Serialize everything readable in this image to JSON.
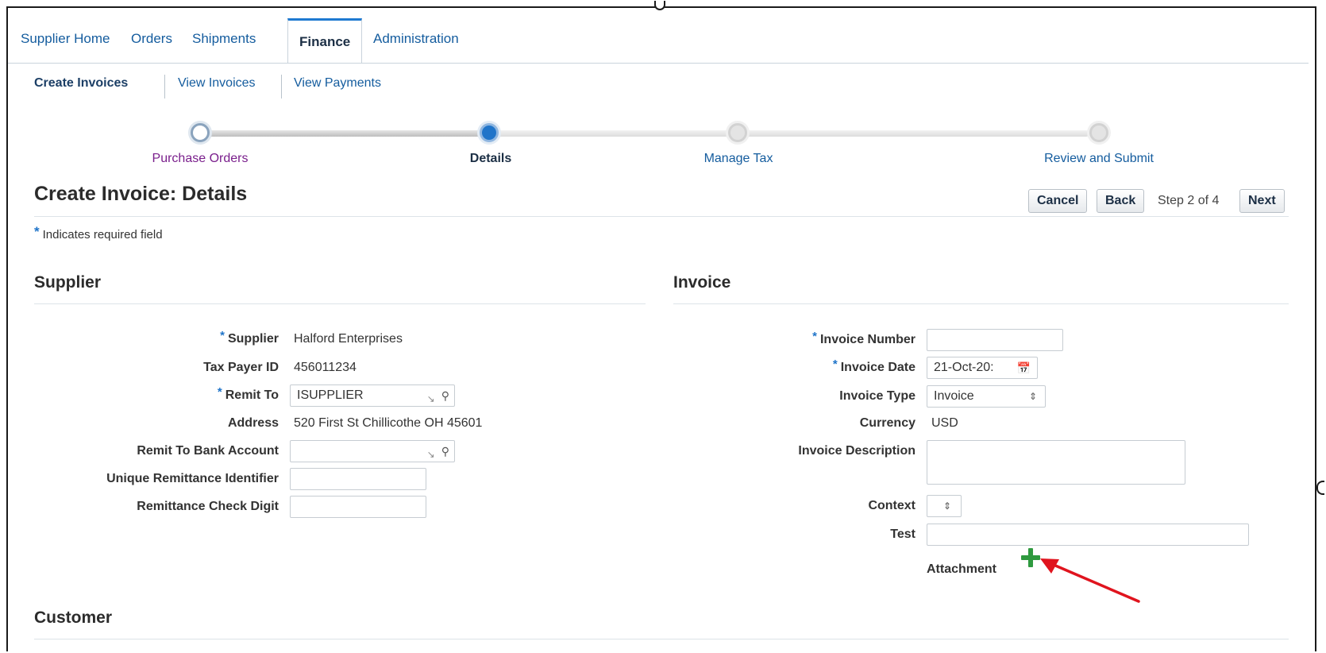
{
  "tabs": [
    {
      "label": "Supplier Home"
    },
    {
      "label": "Orders"
    },
    {
      "label": "Shipments"
    },
    {
      "label": "Finance"
    },
    {
      "label": "Administration"
    }
  ],
  "active_tab": "Finance",
  "subnav": [
    {
      "label": "Create Invoices"
    },
    {
      "label": "View Invoices"
    },
    {
      "label": "View Payments"
    }
  ],
  "train": [
    {
      "label": "Purchase Orders",
      "state": "visited"
    },
    {
      "label": "Details",
      "state": "current"
    },
    {
      "label": "Manage Tax",
      "state": "future"
    },
    {
      "label": "Review and Submit",
      "state": "future"
    }
  ],
  "page": {
    "title": "Create Invoice: Details",
    "required_note": "Indicates required field",
    "required_marker": "*",
    "step_text": "Step 2 of 4"
  },
  "buttons": {
    "cancel": "Cancel",
    "back": "Back",
    "next": "Next"
  },
  "supplier": {
    "title": "Supplier",
    "supplier_label": "Supplier",
    "supplier_value": "Halford Enterprises",
    "tax_payer_label": "Tax Payer ID",
    "tax_payer_value": "456011234",
    "remit_to_label": "Remit To",
    "remit_to_value": "ISUPPLIER",
    "address_label": "Address",
    "address_value": "520 First St Chillicothe OH 45601",
    "bank_account_label": "Remit To Bank Account",
    "bank_account_value": "",
    "unique_remit_label": "Unique Remittance Identifier",
    "unique_remit_value": "",
    "check_digit_label": "Remittance Check Digit",
    "check_digit_value": ""
  },
  "invoice": {
    "title": "Invoice",
    "number_label": "Invoice Number",
    "number_value": "",
    "date_label": "Invoice Date",
    "date_value": "21-Oct-20:",
    "type_label": "Invoice Type",
    "type_value": "Invoice",
    "currency_label": "Currency",
    "currency_value": "USD",
    "description_label": "Invoice Description",
    "description_value": "",
    "context_label": "Context",
    "context_value": "",
    "test_label": "Test",
    "test_value": "",
    "attachment_label": "Attachment"
  },
  "customer": {
    "title": "Customer"
  },
  "colors": {
    "link": "#145c9e",
    "visited": "#7a1f8c",
    "accent": "#1f74c9",
    "add_green": "#2f9a3f",
    "annotation_arrow": "#e0141e"
  }
}
